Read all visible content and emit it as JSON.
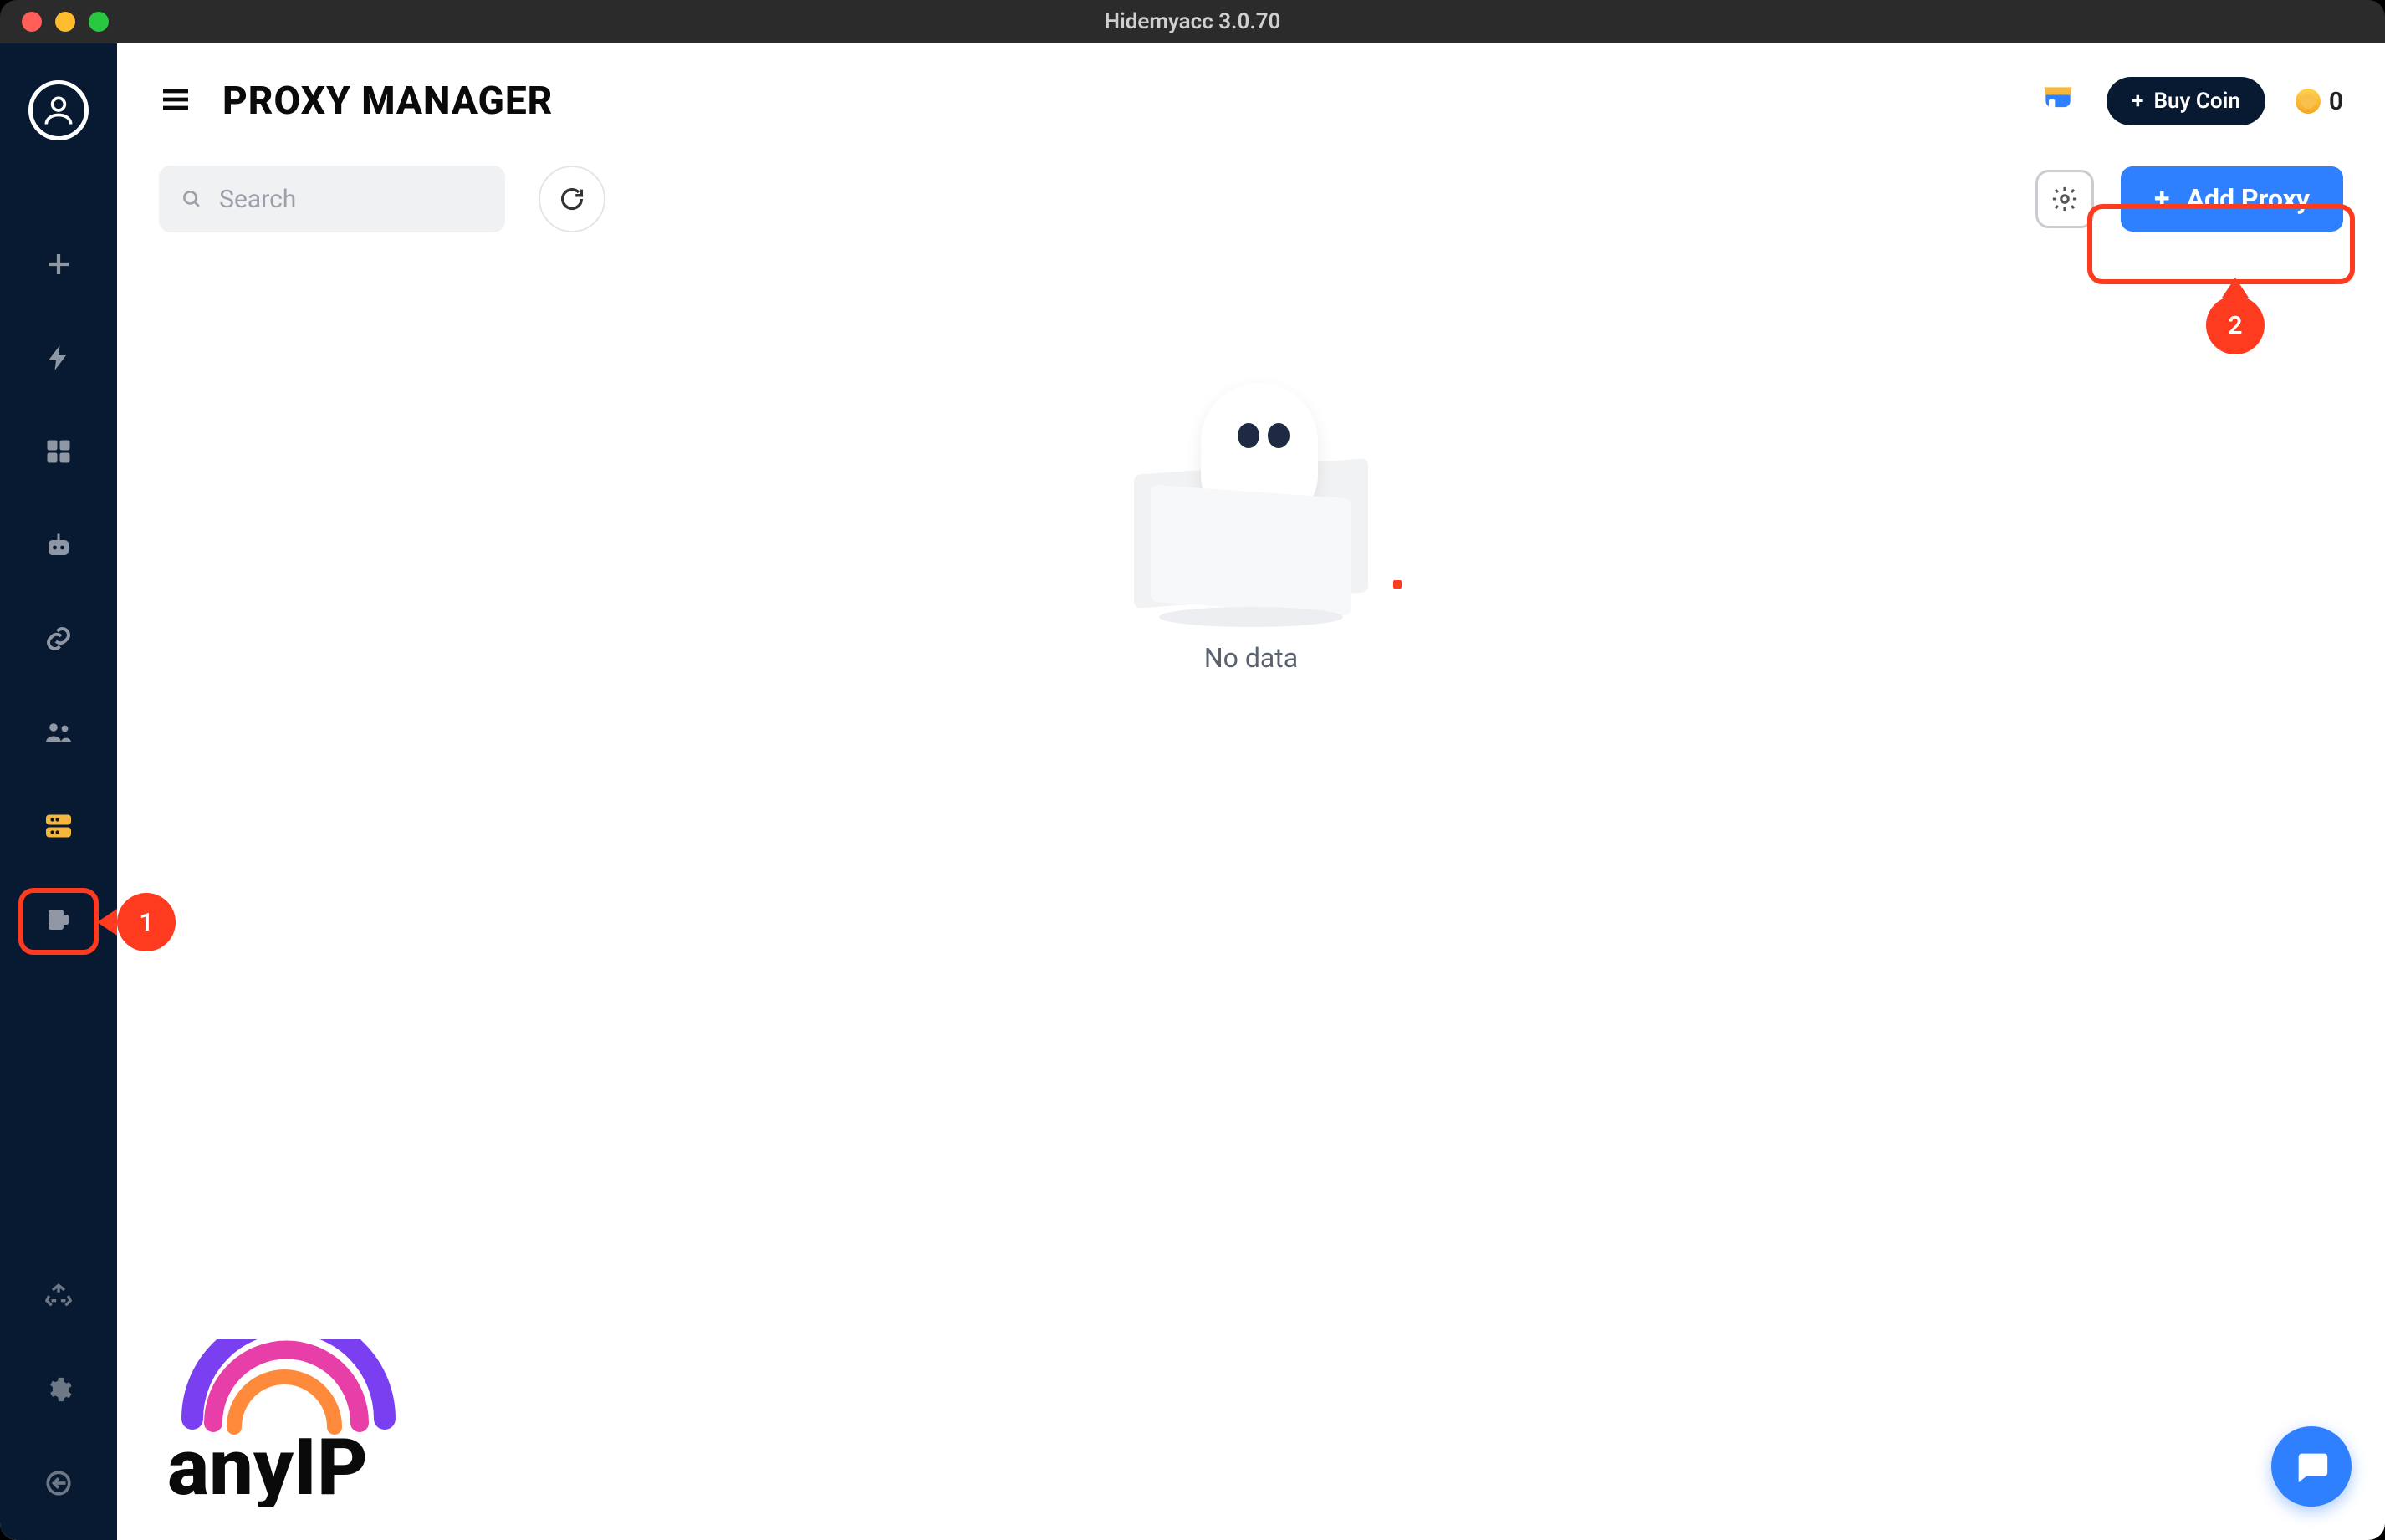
{
  "window": {
    "title": "Hidemyacc 3.0.70"
  },
  "page": {
    "title": "PROXY MANAGER"
  },
  "header": {
    "buy_coin_label": "Buy Coin",
    "coin_balance": "0"
  },
  "toolbar": {
    "search_placeholder": "Search",
    "add_proxy_label": "Add Proxy"
  },
  "sidebar": {
    "items": [
      {
        "id": "new",
        "icon": "plus-icon"
      },
      {
        "id": "quick",
        "icon": "bolt-icon"
      },
      {
        "id": "apps",
        "icon": "grid-icon"
      },
      {
        "id": "automation",
        "icon": "robot-icon"
      },
      {
        "id": "sync",
        "icon": "link-icon"
      },
      {
        "id": "team",
        "icon": "team-icon"
      },
      {
        "id": "proxy",
        "icon": "server-icon",
        "active": true
      },
      {
        "id": "extensions",
        "icon": "extensions-icon"
      }
    ],
    "bottom_items": [
      {
        "id": "recycle",
        "icon": "recycle-icon"
      },
      {
        "id": "settings",
        "icon": "gear-icon"
      },
      {
        "id": "logout",
        "icon": "logout-icon"
      }
    ]
  },
  "empty_state": {
    "message": "No data"
  },
  "callouts": {
    "one": "1",
    "two": "2"
  },
  "branding": {
    "logo_text": "anyIP"
  }
}
